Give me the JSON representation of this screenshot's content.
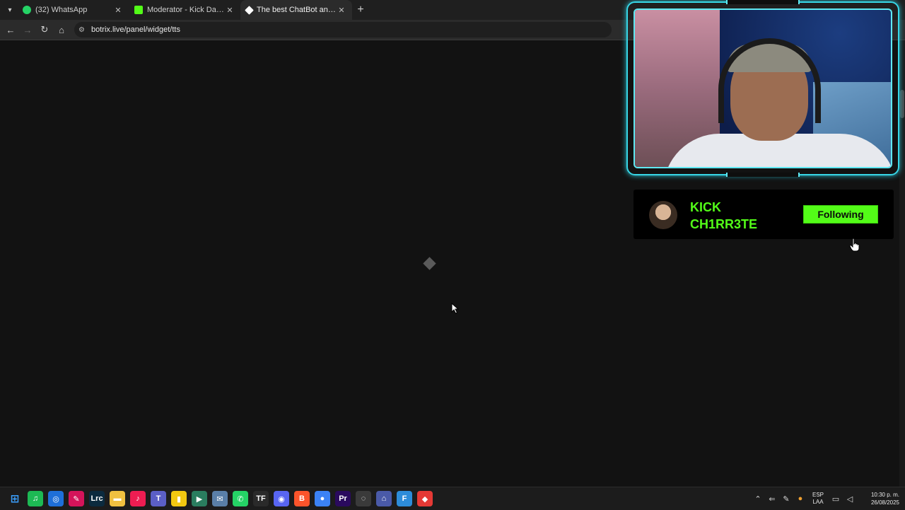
{
  "browser": {
    "tabs": [
      {
        "label": "(32) WhatsApp",
        "color": "#25d366",
        "active": false
      },
      {
        "label": "Moderator - Kick Dashboard",
        "color": "#53fc18",
        "active": false
      },
      {
        "label": "The best ChatBot and Widgets",
        "color": "#ffffff",
        "active": true
      }
    ],
    "new_tab_glyph": "+",
    "close_glyph": "✕",
    "url": "botrix.live/panel/widget/tts"
  },
  "overlay": {
    "channel_name_line1": "KICK",
    "channel_name_line2": "CH1RR3TE",
    "follow_label": "Following",
    "accent": "#53fc18",
    "frame_color": "#37d6e6"
  },
  "taskbar": {
    "apps": [
      {
        "name": "spotify",
        "glyph": "♫",
        "bg": "#1db954"
      },
      {
        "name": "app-blue",
        "glyph": "◎",
        "bg": "#1e6fd9"
      },
      {
        "name": "app-pink",
        "glyph": "✎",
        "bg": "#d4145a"
      },
      {
        "name": "lightroom",
        "glyph": "Lrc",
        "bg": "#0b2a3e"
      },
      {
        "name": "file-explorer",
        "glyph": "▬",
        "bg": "#f0c040"
      },
      {
        "name": "tiktok",
        "glyph": "♪",
        "bg": "#ee1d52"
      },
      {
        "name": "teams",
        "glyph": "T",
        "bg": "#5b5fc7"
      },
      {
        "name": "power-bi",
        "glyph": "▮",
        "bg": "#f2c811"
      },
      {
        "name": "app-arrow",
        "glyph": "▶",
        "bg": "#2a7d5f"
      },
      {
        "name": "app-mail",
        "glyph": "✉",
        "bg": "#5a7fa8"
      },
      {
        "name": "whatsapp",
        "glyph": "✆",
        "bg": "#25d366"
      },
      {
        "name": "app-tf",
        "glyph": "TF",
        "bg": "#2a2a2a"
      },
      {
        "name": "discord",
        "glyph": "◉",
        "bg": "#5865f2"
      },
      {
        "name": "brave",
        "glyph": "B",
        "bg": "#fb542b"
      },
      {
        "name": "chrome",
        "glyph": "●",
        "bg": "#3b82f6"
      },
      {
        "name": "premiere",
        "glyph": "Pr",
        "bg": "#2a0a5e"
      },
      {
        "name": "app-circle",
        "glyph": "◌",
        "bg": "#3a3a3a"
      },
      {
        "name": "controller",
        "glyph": "⌂",
        "bg": "#4a5aa8"
      },
      {
        "name": "app-f",
        "glyph": "F",
        "bg": "#2d8cd9"
      },
      {
        "name": "app-red",
        "glyph": "◆",
        "bg": "#e53935"
      }
    ],
    "lang_line1": "ESP",
    "lang_line2": "LAA",
    "time": "10:30 p. m.",
    "date": "26/08/2025"
  }
}
